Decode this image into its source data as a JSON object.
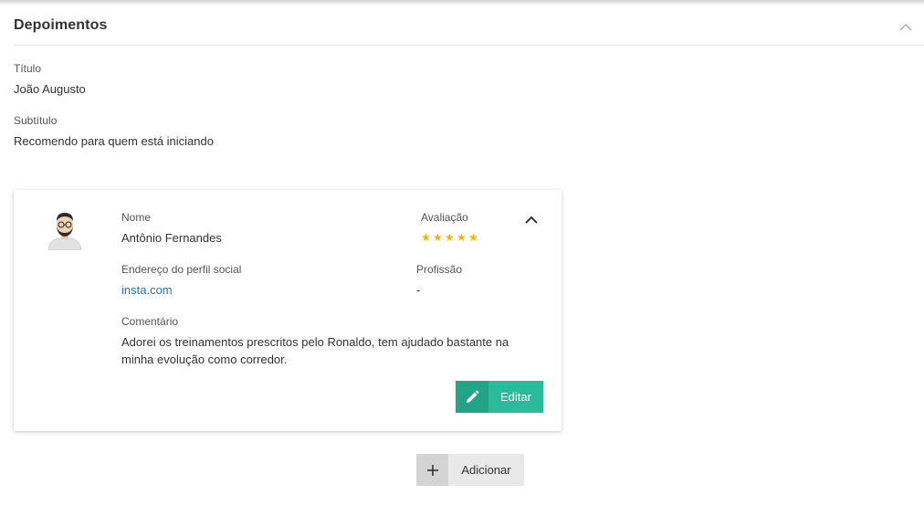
{
  "section": {
    "title": "Depoimentos"
  },
  "fields": {
    "titulo_label": "Título",
    "titulo_value": "João Augusto",
    "subtitulo_label": "Subtítulo",
    "subtitulo_value": "Recomendo para quem está iniciando"
  },
  "testimonial": {
    "name_label": "Nome",
    "name_value": "Antônio Fernandes",
    "rating_label": "Avaliação",
    "rating_value": 5,
    "rating_max": 5,
    "social_label": "Endereço do perfil social",
    "social_value": "insta.com",
    "profession_label": "Profissão",
    "profession_value": "-",
    "comment_label": "Comentário",
    "comment_value": "Adorei os treinamentos prescritos pelo Ronaldo, tem ajudado bastante na minha evolução como corredor.",
    "edit_label": "Editar"
  },
  "actions": {
    "add_label": "Adicionar"
  },
  "colors": {
    "accent": "#2bbb9b",
    "accent_dark": "#23a486",
    "star": "#f5b301",
    "link": "#2a73b4"
  },
  "icons": {
    "section_toggle": "chevron-up-icon",
    "card_toggle": "chevron-up-icon",
    "edit": "pencil-icon",
    "add": "plus-icon",
    "rating": "star-icon"
  }
}
